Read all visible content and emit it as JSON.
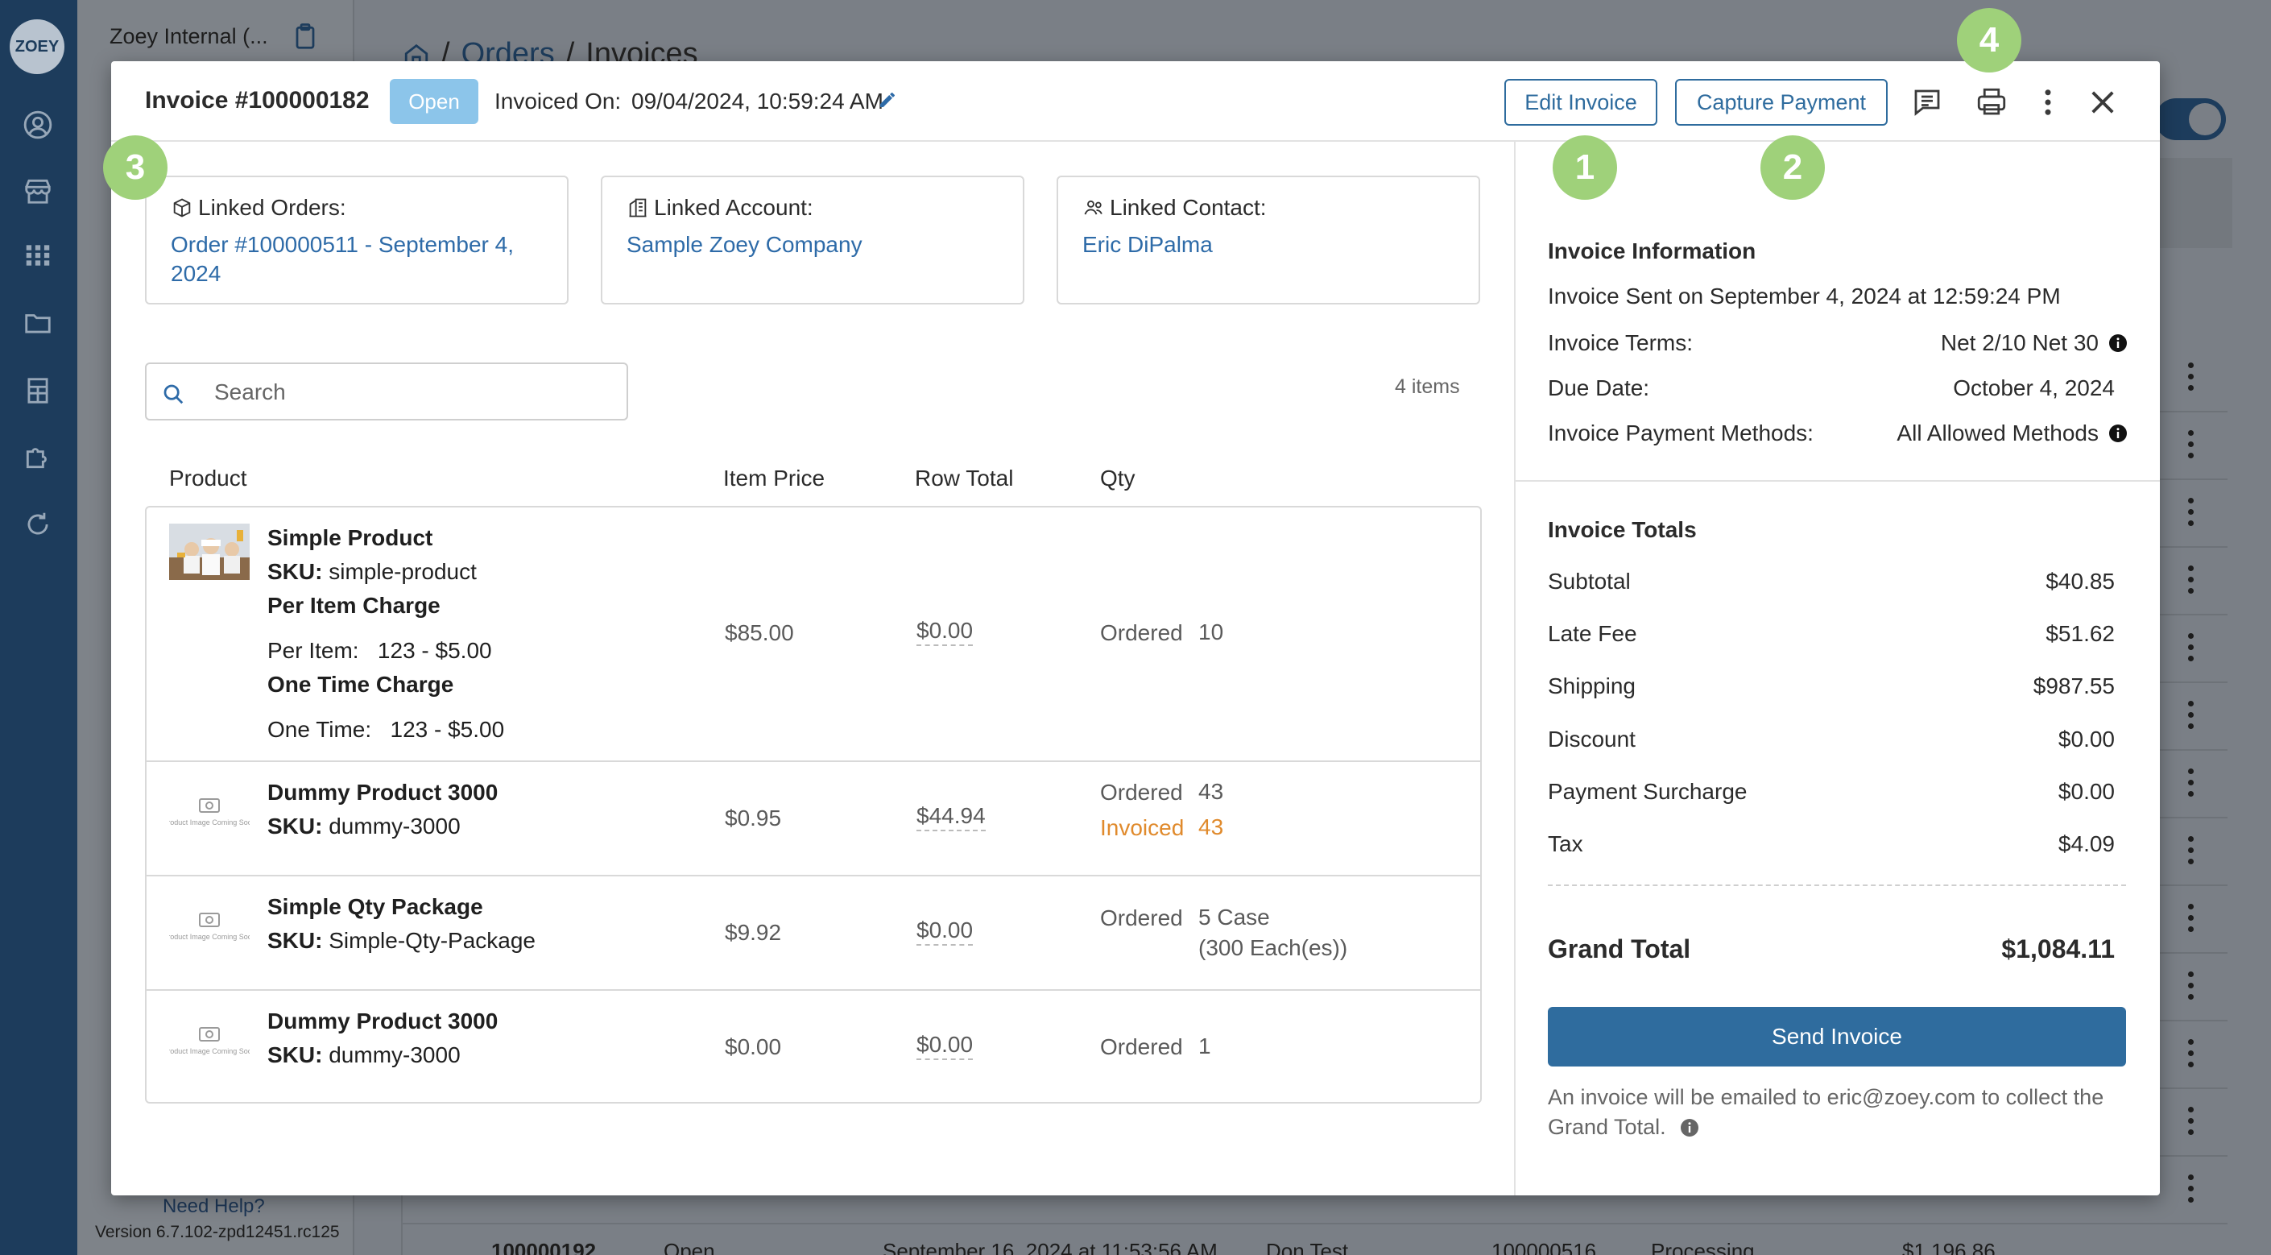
{
  "sidebar": {
    "logo": "ZOEY",
    "panel_title": "Zoey Internal (...",
    "help": "Need Help?",
    "version": "Version 6.7.102-zpd12451.rc125"
  },
  "background": {
    "breadcrumb": {
      "sep": "/",
      "orders": "Orders",
      "invoices": "Invoices"
    },
    "last_row": {
      "id": "100000192",
      "status": "Open",
      "date": "September 16, 2024 at 11:53:56 AM",
      "name": "Don Test",
      "order": "100000516",
      "state": "Processing",
      "amount": "$1,196.86"
    }
  },
  "modal": {
    "title": "Invoice #100000182",
    "status_badge": "Open",
    "invoiced_on_label": "Invoiced On:",
    "invoiced_on_value": "09/04/2024, 10:59:24 AM",
    "edit_invoice": "Edit Invoice",
    "capture_payment": "Capture Payment",
    "linked": {
      "orders_label": "Linked Orders:",
      "orders_value": "Order #100000511 - September 4, 2024",
      "account_label": "Linked Account:",
      "account_value": "Sample Zoey Company",
      "contact_label": "Linked Contact:",
      "contact_value": "Eric DiPalma"
    },
    "search_placeholder": "Search",
    "items_count": "4 items",
    "columns": {
      "product": "Product",
      "item_price": "Item Price",
      "row_total": "Row Total",
      "qty": "Qty"
    },
    "sku_label": "SKU:",
    "ordered_label": "Ordered",
    "invoiced_label": "Invoiced",
    "placeholder_image_text": "Product Image Coming Soon",
    "rows": [
      {
        "name": "Simple Product",
        "sku": "simple-product",
        "option1_title": "Per Item Charge",
        "option1_value": "Per Item:   123 - $5.00",
        "option2_title": "One Time Charge",
        "option2_value": "One Time:   123 - $5.00",
        "price": "$85.00",
        "row_total": "$0.00",
        "ordered": "10"
      },
      {
        "name": "Dummy Product 3000",
        "sku": "dummy-3000",
        "price": "$0.95",
        "row_total": "$44.94",
        "ordered": "43",
        "invoiced": "43"
      },
      {
        "name": "Simple Qty Package",
        "sku": "Simple-Qty-Package",
        "price": "$9.92",
        "row_total": "$0.00",
        "ordered": "5 Case",
        "ordered_sub": "(300 Each(es))"
      },
      {
        "name": "Dummy Product 3000",
        "sku": "dummy-3000",
        "price": "$0.00",
        "row_total": "$0.00",
        "ordered": "1"
      }
    ],
    "info": {
      "heading": "Invoice Information",
      "sent": "Invoice Sent on September 4, 2024 at 12:59:24 PM",
      "terms_label": "Invoice Terms:",
      "terms_value": "Net 2/10 Net 30",
      "due_label": "Due Date:",
      "due_value": "October 4, 2024",
      "methods_label": "Invoice Payment Methods:",
      "methods_value": "All Allowed Methods"
    },
    "totals": {
      "heading": "Invoice Totals",
      "subtotal_label": "Subtotal",
      "subtotal": "$40.85",
      "late_fee_label": "Late Fee",
      "late_fee": "$51.62",
      "shipping_label": "Shipping",
      "shipping": "$987.55",
      "discount_label": "Discount",
      "discount": "$0.00",
      "surcharge_label": "Payment Surcharge",
      "surcharge": "$0.00",
      "tax_label": "Tax",
      "tax": "$4.09",
      "grand_label": "Grand Total",
      "grand": "$1,084.11"
    },
    "send_invoice": "Send Invoice",
    "send_note": "An invoice will be emailed to eric@zoey.com to collect the Grand Total."
  },
  "callouts": [
    "1",
    "2",
    "3",
    "4"
  ],
  "colors": {
    "accent": "#2f6c9e",
    "rail": "#1d3c5c",
    "badge": "#8cc5ea",
    "invoiced": "#e08a2c",
    "callout": "#9fd17a"
  }
}
